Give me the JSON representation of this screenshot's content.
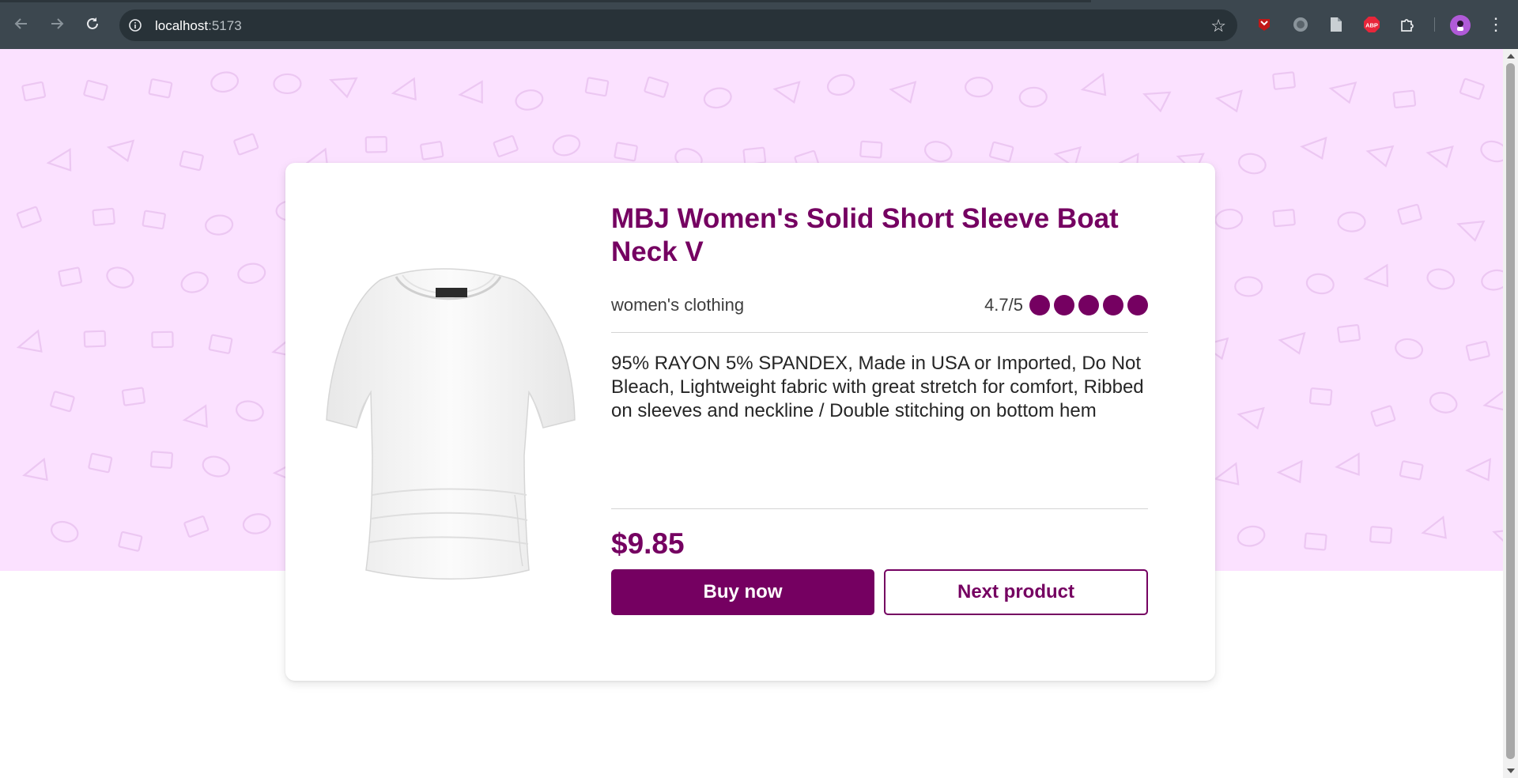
{
  "browser": {
    "url_host": "localhost",
    "url_port": ":5173",
    "extensions": [
      "mcafee-icon",
      "circle-extension-icon",
      "document-extension-icon",
      "adblock-icon",
      "puzzle-icon"
    ],
    "adblock_label": "ABP"
  },
  "product": {
    "title": "MBJ Women's Solid Short Sleeve Boat Neck V",
    "category": "women's clothing",
    "rating_text": "4.7/5",
    "rating_value": 4.7,
    "rating_max": 5,
    "description": "95% RAYON 5% SPANDEX, Made in USA or Imported, Do Not Bleach, Lightweight fabric with great stretch for comfort, Ribbed on sleeves and neckline / Double stitching on bottom hem",
    "price": "$9.85",
    "image_alt": "white short sleeve boat neck top"
  },
  "actions": {
    "buy_label": "Buy now",
    "next_label": "Next product"
  },
  "colors": {
    "accent": "#750061",
    "hero_background": "#fbe1ff",
    "pattern": "#e9c2f0"
  }
}
